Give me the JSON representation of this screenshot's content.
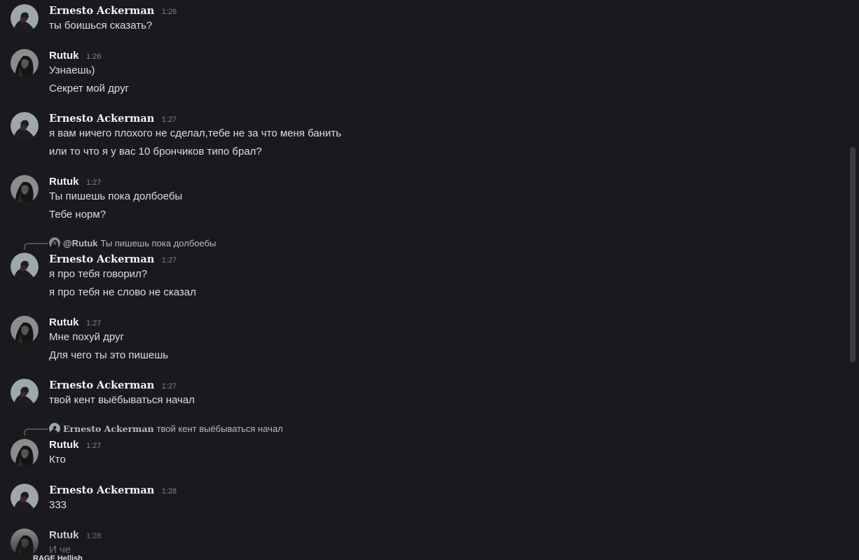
{
  "users": {
    "ernesto": {
      "name": "Ernesto Ackerman"
    },
    "rutuk": {
      "name": "Rutuk"
    }
  },
  "messages": [
    {
      "author": "Ernesto Ackerman",
      "time": "1:26",
      "lines": [
        "ты боишься сказать?"
      ]
    },
    {
      "author": "Rutuk",
      "time": "1:26",
      "lines": [
        "Узнаешь)",
        "Секрет мой друг"
      ]
    },
    {
      "author": "Ernesto Ackerman",
      "time": "1:27",
      "lines": [
        "я вам ничего плохого не сделал,тебе не за что меня банить",
        "или то что я у вас 10 брончиков типо брал?"
      ]
    },
    {
      "author": "Rutuk",
      "time": "1:27",
      "lines": [
        "Ты пишешь пока долбоебы",
        "Тебе норм?"
      ]
    },
    {
      "author": "Ernesto Ackerman",
      "time": "1:27",
      "reply": {
        "name": "@Rutuk",
        "text": "Ты пишешь пока долбоебы"
      },
      "lines": [
        "я про тебя говорил?",
        "я про тебя не слово не сказал"
      ]
    },
    {
      "author": "Rutuk",
      "time": "1:27",
      "lines": [
        "Мне похуй друг",
        "Для чего ты это пишешь"
      ]
    },
    {
      "author": "Ernesto Ackerman",
      "time": "1:27",
      "lines": [
        "твой кент выёбываться начал"
      ]
    },
    {
      "author": "Rutuk",
      "time": "1:27",
      "reply": {
        "name": "Ernesto Ackerman",
        "text": "твой кент выёбываться начал"
      },
      "lines": [
        "Кто"
      ]
    },
    {
      "author": "Ernesto Ackerman",
      "time": "1:28",
      "lines": [
        "333"
      ]
    },
    {
      "author": "Rutuk",
      "time": "1:28",
      "lines": [
        "И че"
      ]
    }
  ],
  "typing_indicator": "RAGE Hellish",
  "colors": {
    "background": "#1a1a1e",
    "text": "#dbdee1",
    "author": "#f2f3f5",
    "timestamp": "#80848e"
  },
  "icons": {
    "ernesto_avatar": "avatar-ernesto-icon",
    "rutuk_avatar": "avatar-rutuk-icon"
  }
}
